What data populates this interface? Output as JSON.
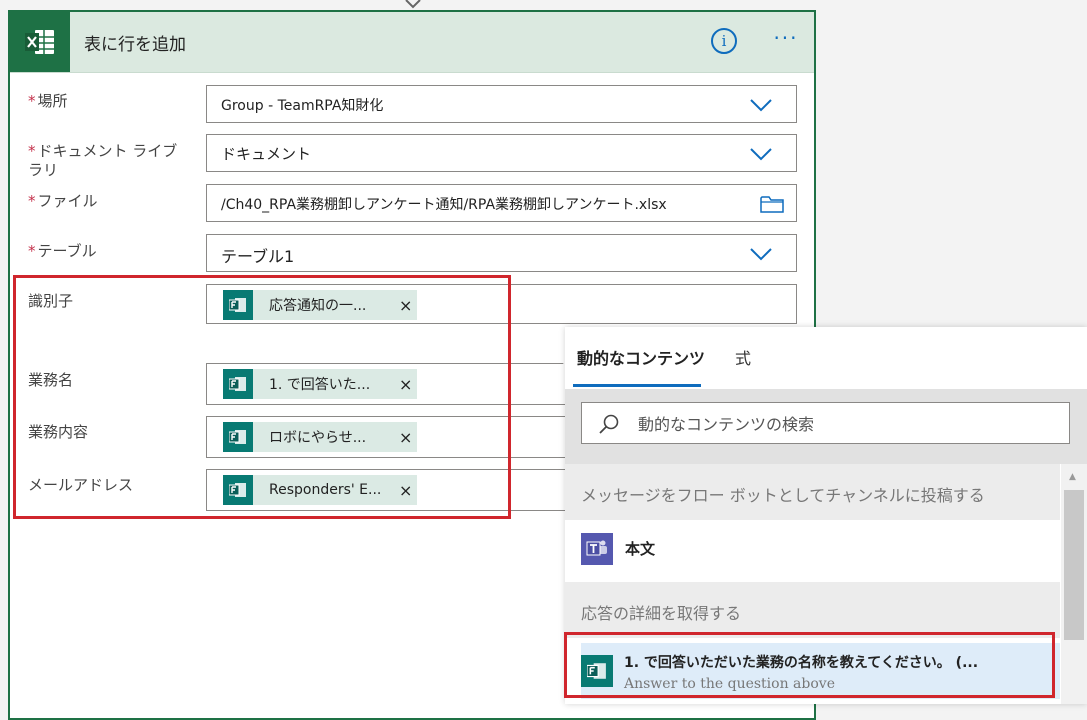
{
  "card": {
    "title": "表に行を追加",
    "icon": "excel-icon",
    "info_icon": "info-icon",
    "more_icon": "more-options-icon",
    "info_glyph": "i",
    "more_glyph": "···"
  },
  "fields": {
    "location": {
      "label": "場所",
      "value": "Group - TeamRPA知財化"
    },
    "library": {
      "label_line1": "ドキュメント ライブ",
      "label_line2": "ラリ",
      "value": "ドキュメント"
    },
    "file": {
      "label": "ファイル",
      "value": "/Ch40_RPA業務棚卸しアンケート通知/RPA業務棚卸しアンケート.xlsx"
    },
    "table": {
      "label": "テーブル",
      "value": "テーブル1"
    },
    "required_mark": "*"
  },
  "mapped": {
    "id": {
      "label": "識別子",
      "token": "応答通知の一..."
    },
    "task_name": {
      "label": "業務名",
      "token": "1. で回答いた..."
    },
    "task_content": {
      "label": "業務内容",
      "token": "ロボにやらせ..."
    },
    "email": {
      "label": "メールアドレス",
      "token": "Responders' E..."
    },
    "remove_glyph": "×"
  },
  "dynamic_panel": {
    "tabs": [
      "動的なコンテンツ",
      "式"
    ],
    "active_tab": "動的なコンテンツ",
    "search_placeholder": "動的なコンテンツの検索",
    "sections": [
      {
        "header": "メッセージをフロー ボットとしてチャンネルに投稿する",
        "items": [
          {
            "title": "本文",
            "icon": "teams-icon"
          }
        ]
      },
      {
        "header": "応答の詳細を取得する",
        "items": [
          {
            "title": "1. で回答いただいた業務の名称を教えてください。 (...",
            "subtitle": "Answer to the question above",
            "icon": "forms-icon"
          }
        ]
      }
    ]
  },
  "colors": {
    "excel_green": "#1e7145",
    "forms_teal": "#087a73",
    "teams_purple": "#5558af",
    "accent_blue": "#0f6cbd",
    "highlight_red": "#d0262d",
    "required_red": "#c4314b"
  }
}
